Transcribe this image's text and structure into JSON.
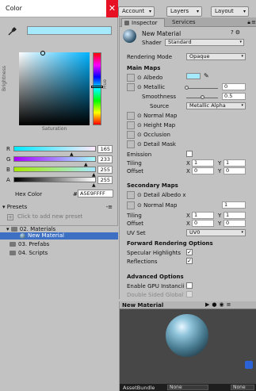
{
  "colors": {
    "picked": "#a5e9ff",
    "selection": "#3d6fc2",
    "close": "#e81123"
  },
  "color_picker": {
    "title": "Color",
    "close_glyph": "✕",
    "brightness_label": "Brightness",
    "saturation_label": "Saturation",
    "hue_label": "Hue",
    "channels": [
      {
        "label": "R",
        "value": "165"
      },
      {
        "label": "G",
        "value": "233"
      },
      {
        "label": "B",
        "value": "255"
      },
      {
        "label": "A",
        "value": "255"
      }
    ],
    "hex_label": "Hex Color",
    "hex_hash": "#",
    "hex_value": "A5E9FFFF",
    "presets_header": "Presets",
    "presets_menu": "-≡",
    "add_preset_text": "Click to add new preset"
  },
  "project": {
    "items": [
      {
        "label": "02. Materials"
      },
      {
        "label": "New Material"
      },
      {
        "label": "03. Prefabs"
      },
      {
        "label": "04. Scripts"
      }
    ]
  },
  "toolbar": {
    "account": "Account",
    "layers": "Layers",
    "layout": "Layout"
  },
  "inspector": {
    "tab_inspector": "Inspector",
    "tab_services": "Services",
    "material_name": "New Material",
    "shader_label": "Shader",
    "shader_value": "Standard",
    "rendering_mode_label": "Rendering Mode",
    "rendering_mode_value": "Opaque",
    "main_maps_header": "Main Maps",
    "albedo": "Albedo",
    "metallic": "Metallic",
    "metallic_value": "0",
    "smoothness": "Smoothness",
    "smoothness_value": "0.5",
    "source_label": "Source",
    "source_value": "Metallic Alpha",
    "normal_map": "Normal Map",
    "height_map": "Height Map",
    "occlusion": "Occlusion",
    "detail_mask": "Detail Mask",
    "emission": "Emission",
    "tiling": "Tiling",
    "offset": "Offset",
    "x_label": "X",
    "y_label": "Y",
    "tiling_x": "1",
    "tiling_y": "1",
    "offset_x": "0",
    "offset_y": "0",
    "secondary_maps_header": "Secondary Maps",
    "detail_albedo": "Detail Albedo x",
    "normal_map_2": "Normal Map",
    "normal_map_2_value": "1",
    "tiling2_x": "1",
    "tiling2_y": "1",
    "offset2_x": "0",
    "offset2_y": "0",
    "uv_set_label": "UV Set",
    "uv_set_value": "UV0",
    "forward_header": "Forward Rendering Options",
    "specular_highlights": "Specular Highlights",
    "reflections": "Reflections",
    "advanced_header": "Advanced Options",
    "gpu_instancing": "Enable GPU Instancii",
    "double_sided": "Double Sided Global",
    "check": "✓"
  },
  "preview": {
    "title": "New Material",
    "ab_label": "AssetBundle",
    "ab_value1": "None",
    "ab_value2": "None"
  }
}
